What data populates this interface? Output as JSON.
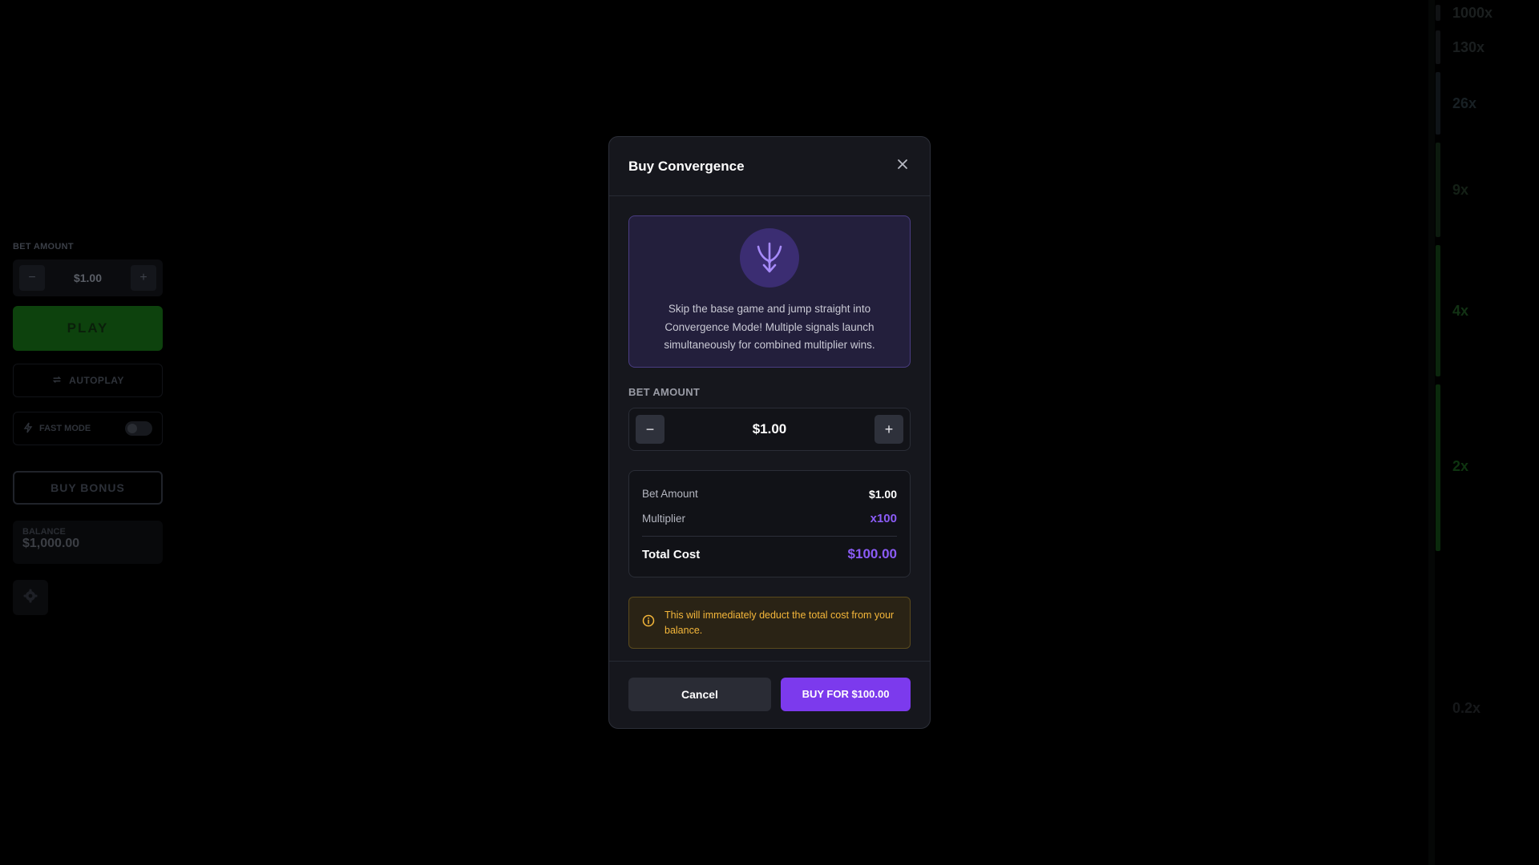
{
  "background": {
    "side_panel": {
      "bet_label": "BET AMOUNT",
      "bet_value": "$1.00",
      "minus": "−",
      "plus": "+",
      "play_label": "PLAY",
      "autoplay_label": "AUTOPLAY",
      "fast_mode_label": "FAST MODE",
      "fast_mode_on": false,
      "buy_bonus_label": "BUY BONUS",
      "balance_label": "BALANCE",
      "balance_value": "$1,000.00"
    },
    "multipliers": [
      {
        "label": "1000x",
        "color": "#1b1f1f"
      },
      {
        "label": "130x",
        "color": "#1a1e1f"
      },
      {
        "label": "26x",
        "color": "#182024"
      },
      {
        "label": "9x",
        "color": "#142016"
      },
      {
        "label": "4x",
        "color": "#123214"
      },
      {
        "label": "2x",
        "color": "#0e3410"
      },
      {
        "label": "0.2x",
        "color": "#16181a"
      }
    ]
  },
  "modal": {
    "title": "Buy Convergence",
    "close_icon": "close-icon",
    "feature_icon": "convergence-arrows-icon",
    "description": "Skip the base game and jump straight into Convergence Mode! Multiple signals launch simultaneously for combined multiplier wins.",
    "bet_section_label": "BET AMOUNT",
    "bet_value": "$1.00",
    "minus": "−",
    "plus": "+",
    "summary": {
      "bet_amount_label": "Bet Amount",
      "bet_amount_value": "$1.00",
      "multiplier_label": "Multiplier",
      "multiplier_value": "x100",
      "total_label": "Total Cost",
      "total_value": "$100.00"
    },
    "warning_icon": "info-circle-icon",
    "warning_text": "This will immediately deduct the total cost from your balance.",
    "cancel_label": "Cancel",
    "buy_label": "BUY FOR $100.00"
  },
  "colors": {
    "accent": "#7c3aed",
    "accent_text": "#8b5cf6",
    "warning": "#f5b73a"
  }
}
